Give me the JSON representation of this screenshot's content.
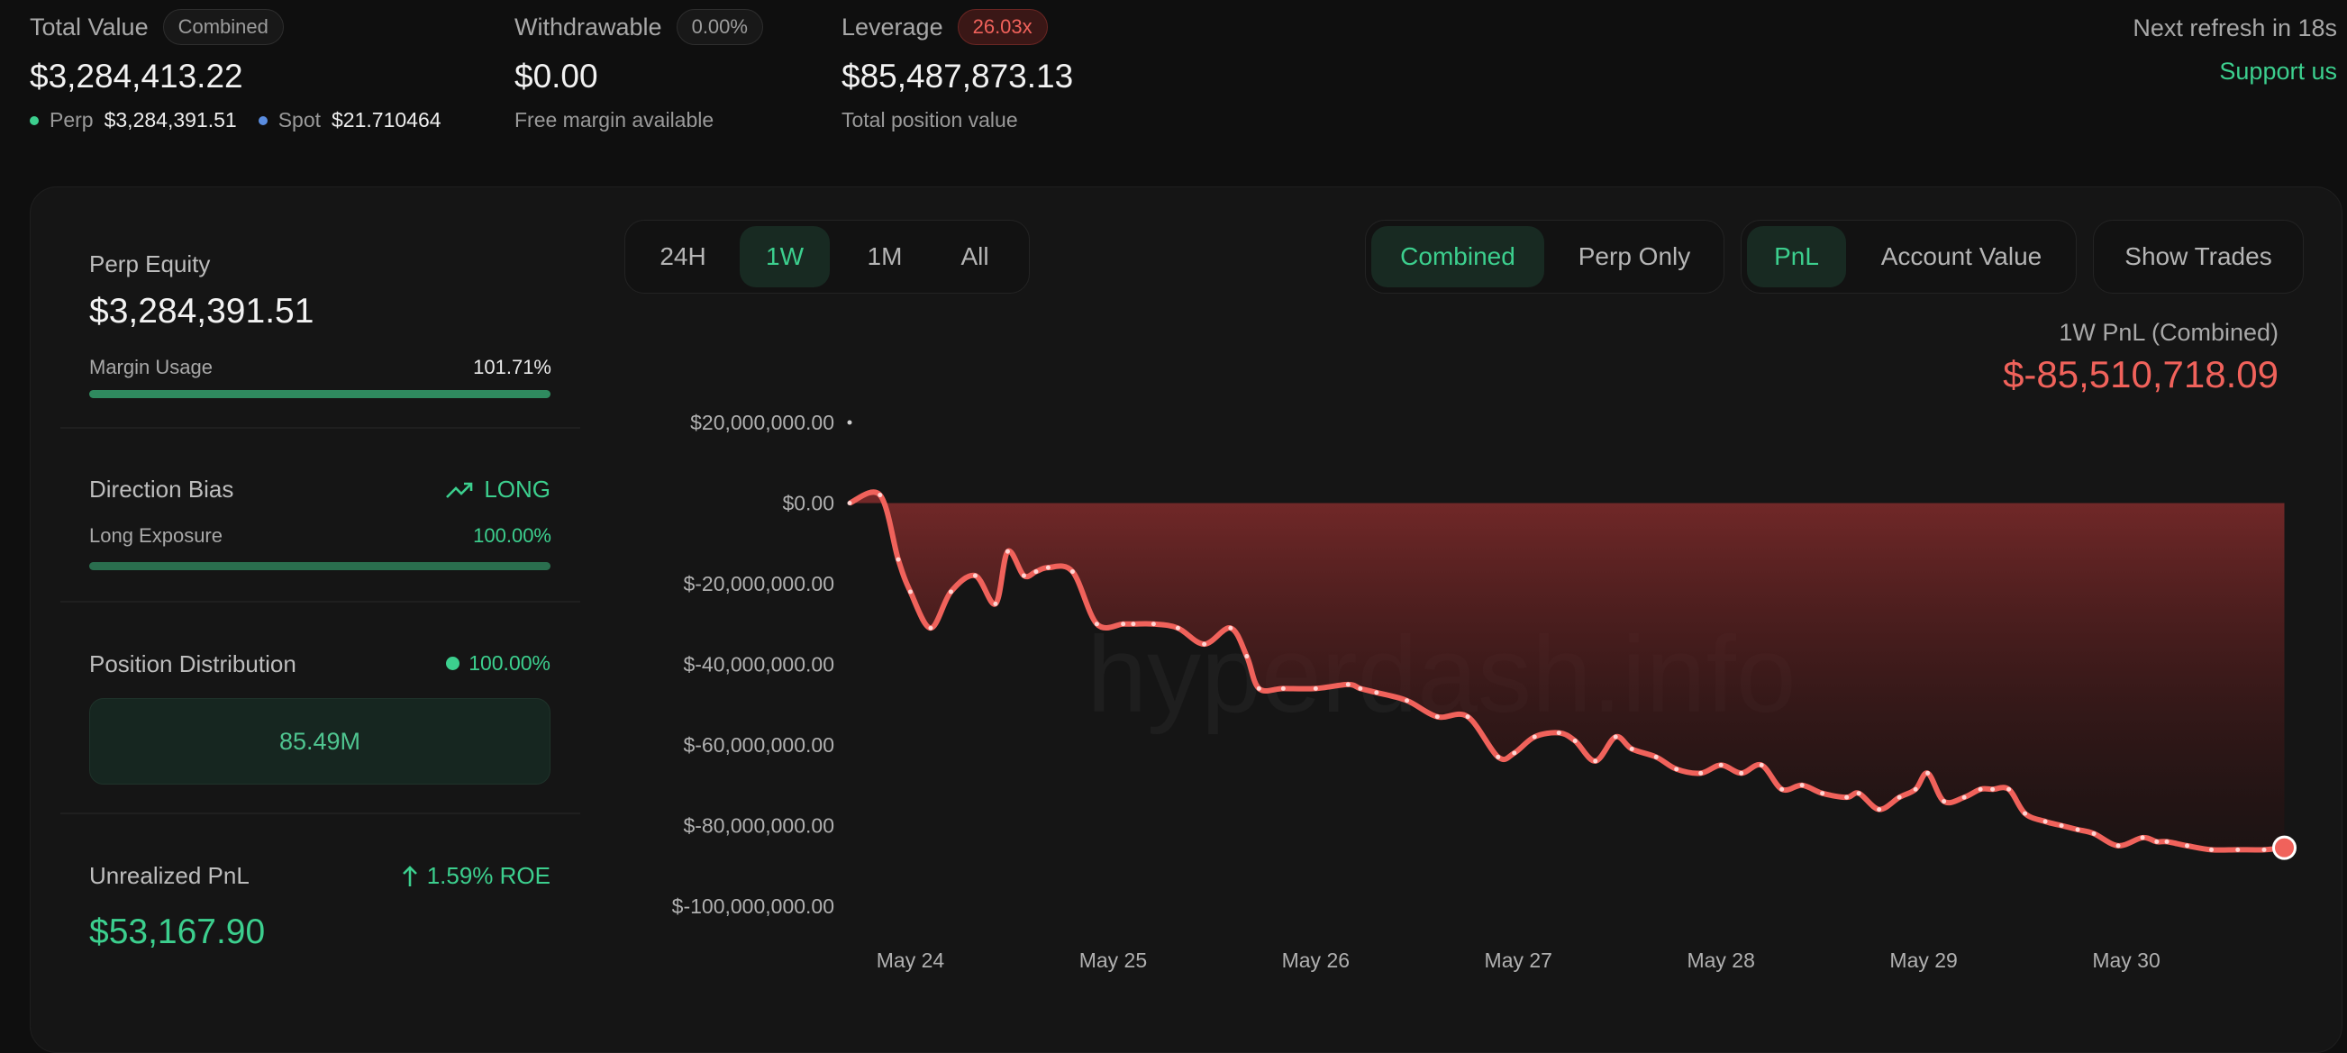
{
  "top": {
    "total_value": {
      "label": "Total Value",
      "badge": "Combined",
      "value": "$3,284,413.22",
      "perp_label": "Perp",
      "perp_value": "$3,284,391.51",
      "spot_label": "Spot",
      "spot_value": "$21.710464"
    },
    "withdrawable": {
      "label": "Withdrawable",
      "badge": "0.00%",
      "value": "$0.00",
      "sub": "Free margin available"
    },
    "leverage": {
      "label": "Leverage",
      "badge": "26.03x",
      "value": "$85,487,873.13",
      "sub": "Total position value"
    },
    "refresh": "Next refresh in 18s",
    "support": "Support us"
  },
  "side": {
    "perp_equity": {
      "label": "Perp Equity",
      "value": "$3,284,391.51",
      "margin_label": "Margin Usage",
      "margin_value": "101.71%",
      "margin_fill": 1.0
    },
    "direction": {
      "label": "Direction Bias",
      "value": "LONG",
      "exposure_label": "Long Exposure",
      "exposure_value": "100.00%",
      "exposure_fill": 1.0
    },
    "distribution": {
      "label": "Position Distribution",
      "value": "100.00%",
      "bar_text": "85.49M"
    },
    "unrealized": {
      "label": "Unrealized PnL",
      "roe": "1.59% ROE",
      "value": "$53,167.90"
    }
  },
  "controls": {
    "ranges": [
      "24H",
      "1W",
      "1M",
      "All"
    ],
    "range_active": "1W",
    "mode": [
      "Combined",
      "Perp Only"
    ],
    "mode_active": "Combined",
    "metric": [
      "PnL",
      "Account Value"
    ],
    "metric_active": "PnL",
    "show_trades": "Show Trades"
  },
  "summary": {
    "label": "1W PnL (Combined)",
    "value": "$-85,510,718.09"
  },
  "watermark": "hyperdash.info",
  "colors": {
    "accent_green": "#3ccf8e",
    "loss_red": "#f0625b",
    "background": "#0f0f0f"
  },
  "chart_data": {
    "type": "area",
    "title": "1W PnL (Combined)",
    "x_tick_labels": [
      "May 24",
      "May 25",
      "May 26",
      "May 27",
      "May 28",
      "May 29",
      "May 30"
    ],
    "y_tick_labels": [
      "$20,000,000.00",
      "$0.00",
      "$-20,000,000.00",
      "$-40,000,000.00",
      "$-60,000,000.00",
      "$-80,000,000.00",
      "$-100,000,000.00"
    ],
    "ylim": [
      -100000000,
      20000000
    ],
    "xlim": [
      -0.3,
      6.8
    ],
    "x_unit": "days from May 24",
    "series": [
      {
        "x": [
          -0.3,
          -0.15,
          -0.06,
          0.0,
          0.1,
          0.2,
          0.32,
          0.42,
          0.48,
          0.56,
          0.62,
          0.68,
          0.8,
          0.92,
          1.05,
          1.1,
          1.2,
          1.32,
          1.45,
          1.58,
          1.66,
          1.72,
          1.84,
          2.0,
          2.16,
          2.22,
          2.3,
          2.45,
          2.6,
          2.75,
          2.9,
          2.98,
          3.08,
          3.2,
          3.28,
          3.38,
          3.48,
          3.56,
          3.68,
          3.78,
          3.9,
          4.0,
          4.1,
          4.2,
          4.3,
          4.4,
          4.5,
          4.62,
          4.68,
          4.78,
          4.88,
          4.96,
          5.02,
          5.1,
          5.2,
          5.28,
          5.34,
          5.42,
          5.5,
          5.6,
          5.68,
          5.76,
          5.84,
          5.96,
          6.08,
          6.15,
          6.2,
          6.3,
          6.42,
          6.55,
          6.68,
          6.78
        ],
        "y": [
          0,
          2000000,
          -14000000,
          -22000000,
          -31000000,
          -22000000,
          -18000000,
          -25000000,
          -12000000,
          -18000000,
          -17000000,
          -16000000,
          -17000000,
          -30000000,
          -30000000,
          -30000000,
          -30000000,
          -31000000,
          -35000000,
          -31000000,
          -38000000,
          -46000000,
          -46000000,
          -46000000,
          -45000000,
          -46000000,
          -47000000,
          -49000000,
          -53000000,
          -53000000,
          -63000000,
          -62000000,
          -58000000,
          -57000000,
          -59000000,
          -64000000,
          -58000000,
          -61000000,
          -63000000,
          -66000000,
          -67000000,
          -65000000,
          -67000000,
          -65000000,
          -71000000,
          -70000000,
          -72000000,
          -73000000,
          -72000000,
          -76000000,
          -73000000,
          -71000000,
          -67000000,
          -74000000,
          -73000000,
          -71000000,
          -71000000,
          -71000000,
          -77000000,
          -79000000,
          -80000000,
          -81000000,
          -82000000,
          -85000000,
          -83000000,
          -84000000,
          -84000000,
          -85000000,
          -86000000,
          -86000000,
          -86000000,
          -85510718
        ]
      }
    ],
    "grid": false,
    "colors": {
      "line": "#f0625b",
      "fill": "#7a2a2a"
    }
  }
}
